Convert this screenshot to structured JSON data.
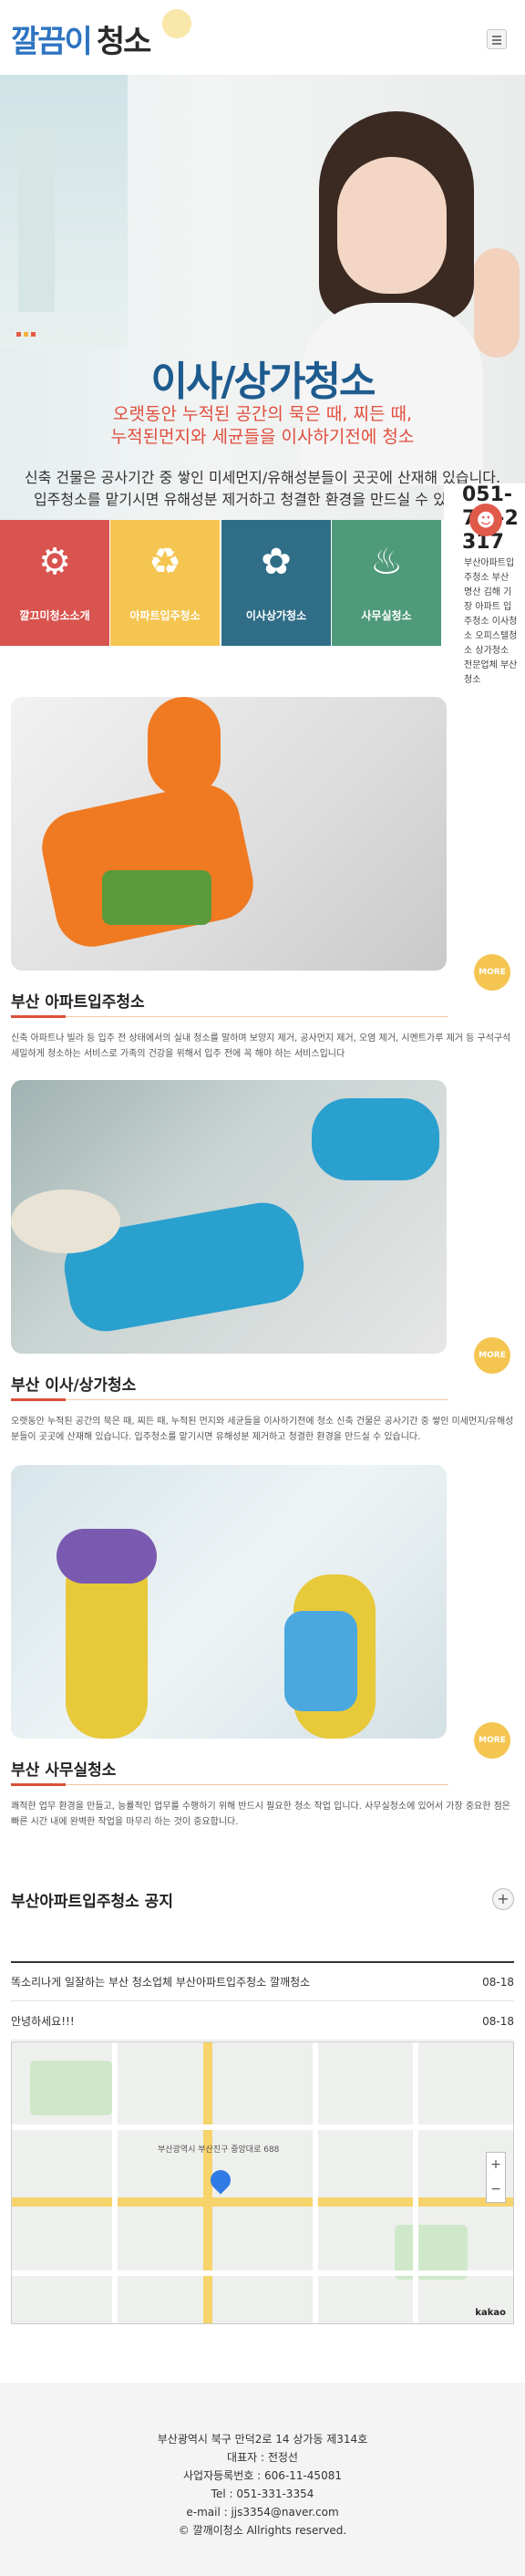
{
  "header": {
    "logo_part1": "깔끔이",
    "logo_part2": "청소",
    "menu_icon": "hamburger-icon"
  },
  "hero": {
    "title": "이사/상가청소",
    "subtitle_line1": "오랫동안 누적된 공간의 묵은 때, 찌든 때,",
    "subtitle_line2": "누적된먼지와 세균들을 이사하기전에 청소",
    "desc_line1": "신축 건물은 공사기간 중 쌓인 미세먼지/유해성분들이 곳곳에 산재해 있습니다.",
    "desc_line2": "입주청소를 맡기시면 유해성분 제거하고 청결한 환경을 만드실 수 있습니다."
  },
  "tiles": [
    {
      "label": "깔끄미청소소개",
      "icon": "vacuum-icon",
      "color": "#d9534f"
    },
    {
      "label": "아파트입주청소",
      "icon": "bucket-icon",
      "color": "#f4c550"
    },
    {
      "label": "이사상가청소",
      "icon": "spray-icon",
      "color": "#2f6e86"
    },
    {
      "label": "사무실청소",
      "icon": "bottle-icon",
      "color": "#4f9a7a"
    }
  ],
  "sidebar": {
    "phone": "051-7__-2317",
    "text": "부산아파트입주청소 부산 명산 김해 기장 아파트 입주청소 이사청소 오피스텔청소 상가청소 전문업체 부산청소"
  },
  "sections": [
    {
      "title": "부산 아파트입주청소",
      "more": "MORE",
      "text": "신축 아파트나 빌라 등 입주 전 상태에서의 실내 청소를 말하며 보양지 제거, 공사먼지 제거, 오염 제거, 시멘트가루 제거 등 구석구석 세밀하게 청소하는 서비스로 가족의 건강을 위해서 입주 전에 꼭 해야 하는 서비스입니다"
    },
    {
      "title": "부산 이사/상가청소",
      "more": "MORE",
      "text": "오랫동안 누적된 공간의 묵은 때, 찌든 때, 누적된 먼지와 세균들을 이사하기전에 청소 신축 건물은 공사기간 중 쌓인 미세먼지/유해성분들이 곳곳에 산재해 있습니다. 입주청소를 맡기시면 유해성분 제거하고 청결한 환경을 만드실 수 있습니다."
    },
    {
      "title": "부산 사무실청소",
      "more": "MORE",
      "text": "쾌적한 업무 환경을 만들고, 능률적인 업무를 수행하기 위해 반드시 필요한 청소 작업 입니다. 사무실청소에 있어서 가장 중요한 점은 빠른 시간 내에 완벽한 작업을 마무리 하는 것이 중요합니다."
    }
  ],
  "notice": {
    "title": "부산아파트입주청소 공지",
    "plus": "+",
    "items": [
      {
        "title": "똑소리나게 일잘하는 부산 청소업체 부산아파트입주청소 깔깨청소",
        "date": "08-18"
      },
      {
        "title": "안녕하세요!!!",
        "date": "08-18"
      }
    ]
  },
  "map": {
    "label_main": "부산광역시 부산진구 중앙대로 688",
    "logo": "kakao",
    "zoom_in": "+",
    "zoom_out": "−"
  },
  "footer": {
    "address": "부산광역시 북구 만덕2로 14 상가동 제314호",
    "ceo": "대표자 : 전정선",
    "biz": "사업자등록번호 : 606-11-45081",
    "tel": "Tel : 051-331-3354",
    "email": "e-mail : jjs3354@naver.com",
    "copy": "© 깔깨이청소 Allrights reserved."
  }
}
